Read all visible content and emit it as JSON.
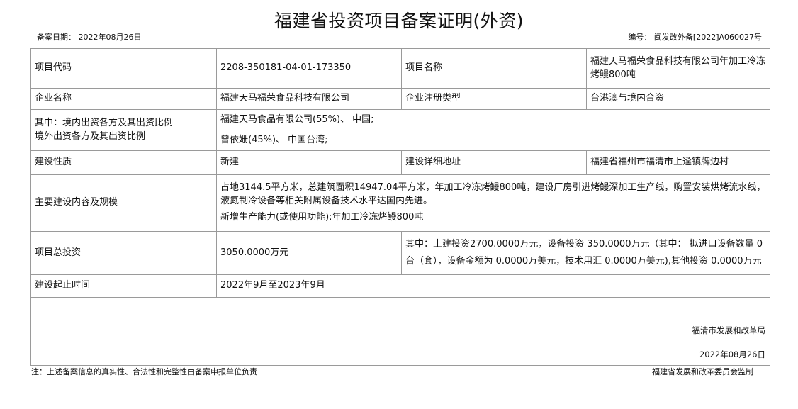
{
  "title": "福建省投资项目备案证明(外资)",
  "filing_date": "备案日期：  2022年08月26日",
  "filing_number": "编号：  闽发改外备[2022]A060027号",
  "rows": {
    "project_code_label": "项目代码",
    "project_code_value": "2208-350181-04-01-173350",
    "project_name_label": "项目名称",
    "project_name_value": "福建天马福荣食品科技有限公司年加工冷冻烤鳗800吨",
    "enterprise_label": "企业名称",
    "enterprise_value": "福建天马福荣食品科技有限公司",
    "reg_type_label": "企业注册类型",
    "reg_type_value": "台港澳与境内合资",
    "investor_label_1": "其中：境内出资各方及其出资比例",
    "investor_label_2": "境外出资各方及其出资比例",
    "domestic_investor": "福建天马食品有限公司(55%)、 中国;",
    "foreign_investor": "曾依姗(45%)、 中国台湾;",
    "nature_label": "建设性质",
    "nature_value": "新建",
    "address_label": "建设详细地址",
    "address_value": "福建省福州市福清市上迳镇牌边村",
    "content_label": "主要建设内容及规模",
    "content_value": "占地3144.5平方米，总建筑面积14947.04平方米，年加工冷冻烤鳗800吨，建设厂房引进烤鳗深加工生产线，购置安装烘烤流水线，液氮制冷设备等相关附属设备技术水平达国内先进。",
    "capacity_value": "新增生产能力(或使用功能):年加工冷冻烤鳗800吨",
    "investment_label": "项目总投资",
    "investment_value": "3050.0000万元",
    "investment_detail": "其中：土建投资2700.0000万元，设备投资 350.0000万元（其中： 拟进口设备数量 0台（套），设备金额为 0.0000万美元，技术用汇 0.0000万美元),其他投资 0.0000万元",
    "period_label": "建设起止时间",
    "period_value": "2022年9月至2023年9月"
  },
  "footer": {
    "org": "福清市发展和改革局",
    "date": "2022年08月26日"
  },
  "note": "注：上述备案信息的真实性、合法性和完整性由备案申报单位负责",
  "supervisor": "福建省发展和改革委员会监制"
}
